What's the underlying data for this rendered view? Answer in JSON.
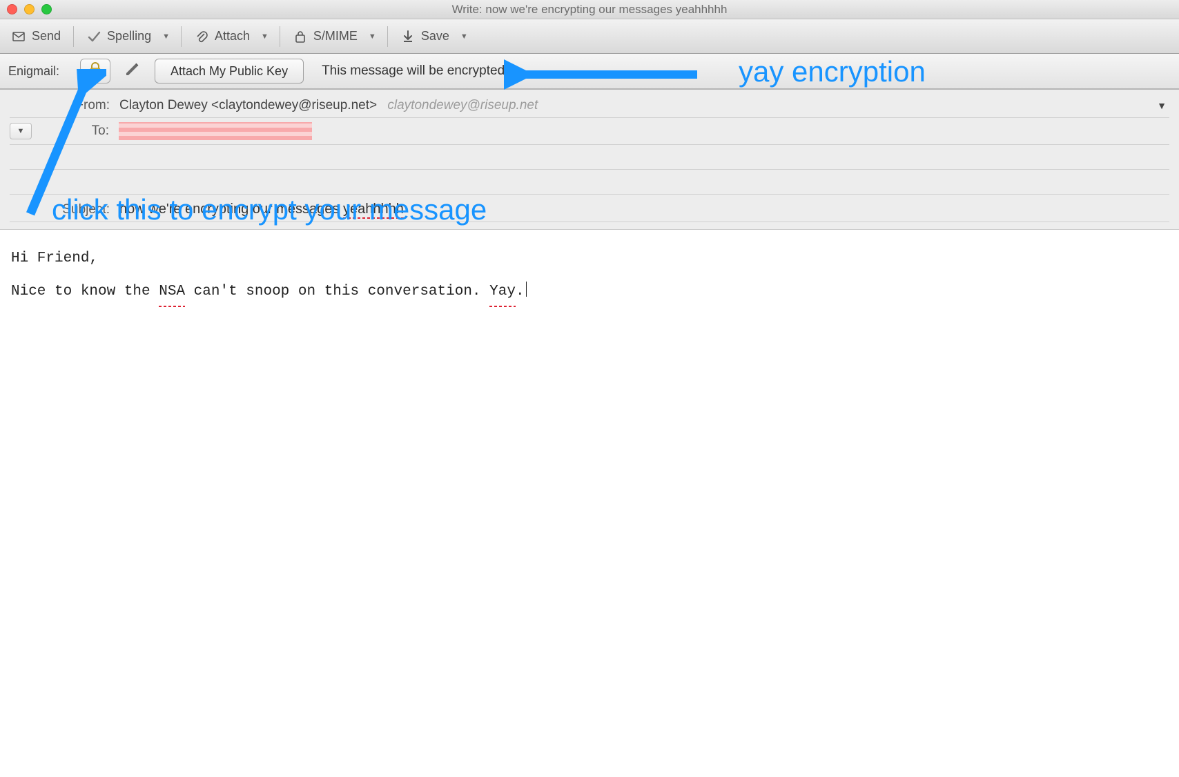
{
  "window": {
    "title": "Write: now we're encrypting our messages yeahhhhh"
  },
  "toolbar": {
    "send": "Send",
    "spelling": "Spelling",
    "attach": "Attach",
    "smime": "S/MIME",
    "save": "Save"
  },
  "enigmail": {
    "label": "Enigmail:",
    "attach_key": "Attach My Public Key",
    "status": "This message will be encrypted"
  },
  "headers": {
    "from_label": "From:",
    "from_value": "Clayton Dewey <claytondewey@riseup.net>",
    "from_ghost": "claytondewey@riseup.net",
    "to_label": "To:",
    "subject_label": "Subject:",
    "subject_prefix": "now we're encrypting our messages ",
    "subject_misspelled": "yeahhhhh"
  },
  "body": {
    "line1": "Hi Friend,",
    "line2_a": "Nice to know the ",
    "line2_b": "NSA",
    "line2_c": " can't snoop on this conversation. ",
    "line2_d": "Yay",
    "line2_e": "."
  },
  "annotations": {
    "top": "yay encryption",
    "bottom": "click this to encrypt your message"
  },
  "colors": {
    "annotation": "#1894ff"
  }
}
